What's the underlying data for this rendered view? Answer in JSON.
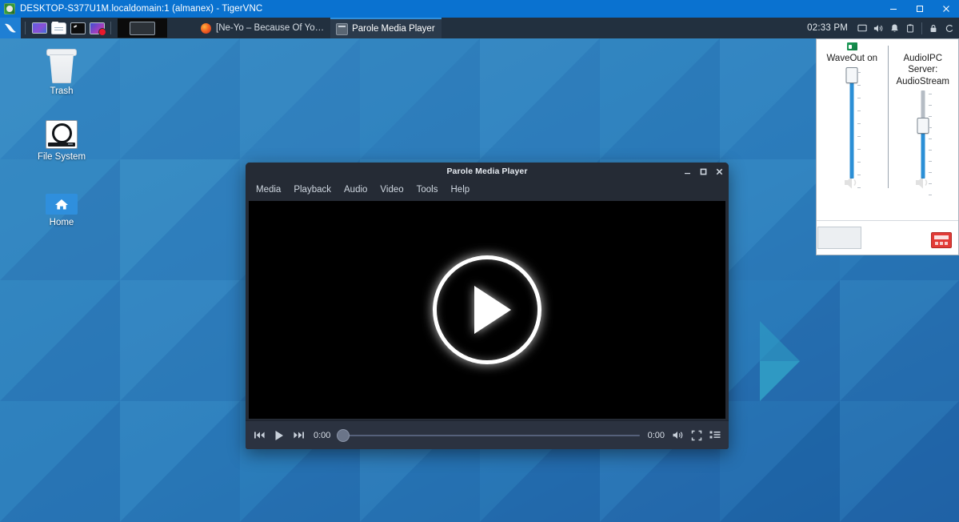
{
  "vnc": {
    "title": "DESKTOP-S377U1M.localdomain:1 (almanex) - TigerVNC",
    "icon": "tigervnc-icon",
    "buttons": [
      {
        "name": "minimize-button",
        "glyph": "minimize-icon"
      },
      {
        "name": "maximize-button",
        "glyph": "maximize-icon"
      },
      {
        "name": "close-button",
        "glyph": "close-icon"
      }
    ]
  },
  "panel": {
    "whisker_icon": "xfce-mouse-icon",
    "launchers": [
      {
        "name": "launcher-display-settings",
        "icon": "display-icon"
      },
      {
        "name": "launcher-file-manager",
        "icon": "folder-icon"
      },
      {
        "name": "launcher-terminal",
        "icon": "terminal-icon"
      },
      {
        "name": "launcher-screen-recorder",
        "icon": "record-icon"
      }
    ],
    "show_desktop": "show-desktop-icon",
    "tasks": [
      {
        "name": "taskbar-item-firefox",
        "label": "[Ne-Yo – Because Of Yo…",
        "icon": "firefox-icon",
        "active": false
      },
      {
        "name": "taskbar-item-parole",
        "label": "Parole Media Player",
        "icon": "window-icon",
        "active": true
      }
    ],
    "clock": "02:33 PM",
    "tray": [
      {
        "name": "tray-display-icon",
        "icon": "monitor-icon"
      },
      {
        "name": "tray-volume-icon",
        "icon": "speaker-icon"
      },
      {
        "name": "tray-notification-icon",
        "icon": "bell-icon"
      },
      {
        "name": "tray-clipboard-icon",
        "icon": "clipboard-icon"
      },
      {
        "name": "tray-lock-icon",
        "icon": "lock-icon"
      }
    ]
  },
  "desktop": {
    "icons": [
      {
        "name": "desktop-icon-trash",
        "label": "Trash",
        "icon": "trash-icon"
      },
      {
        "name": "desktop-icon-file-system",
        "label": "File System",
        "icon": "drive-icon"
      },
      {
        "name": "desktop-icon-home",
        "label": "Home",
        "icon": "home-icon"
      }
    ],
    "wallpaper_colors": {
      "base": "#2a7ab9",
      "light": "#3e93c9",
      "mid": "#2f7fbe",
      "dark": "#1f62a8",
      "darkest": "#1b4f96",
      "teal": "#2f9fc4"
    }
  },
  "parole": {
    "title": "Parole Media Player",
    "window_buttons": [
      {
        "name": "parole-minimize-button",
        "glyph": "minimize-icon"
      },
      {
        "name": "parole-maximize-button",
        "glyph": "maximize-icon"
      },
      {
        "name": "parole-close-button",
        "glyph": "close-icon"
      }
    ],
    "menu": [
      {
        "name": "menu-media",
        "label": "Media"
      },
      {
        "name": "menu-playback",
        "label": "Playback"
      },
      {
        "name": "menu-audio",
        "label": "Audio"
      },
      {
        "name": "menu-video",
        "label": "Video"
      },
      {
        "name": "menu-tools",
        "label": "Tools"
      },
      {
        "name": "menu-help",
        "label": "Help"
      }
    ],
    "video_overlay_icon": "play-circle-icon",
    "controls": {
      "previous_icon": "previous-track-icon",
      "play_icon": "play-icon",
      "next_icon": "next-track-icon",
      "elapsed": "0:00",
      "duration": "0:00",
      "seek_position_percent": 0,
      "volume_icon": "volume-icon",
      "fullscreen_icon": "fullscreen-icon",
      "playlist_icon": "playlist-icon"
    }
  },
  "mixer": {
    "channels": [
      {
        "name": "mixer-channel-waveout",
        "label": "WaveOut on",
        "has_app_icon": true,
        "app_icon": "app-green-icon",
        "level_percent": 96
      },
      {
        "name": "mixer-channel-audioipc",
        "label": "AudioIPC Server: AudioStream",
        "has_app_icon": false,
        "app_icon": "",
        "level_percent": 68
      }
    ],
    "footer": {
      "left_box": "mixer-device-box",
      "right_icon": "mixer-app-red-icon"
    },
    "accent_color": "#2b8fd6"
  }
}
